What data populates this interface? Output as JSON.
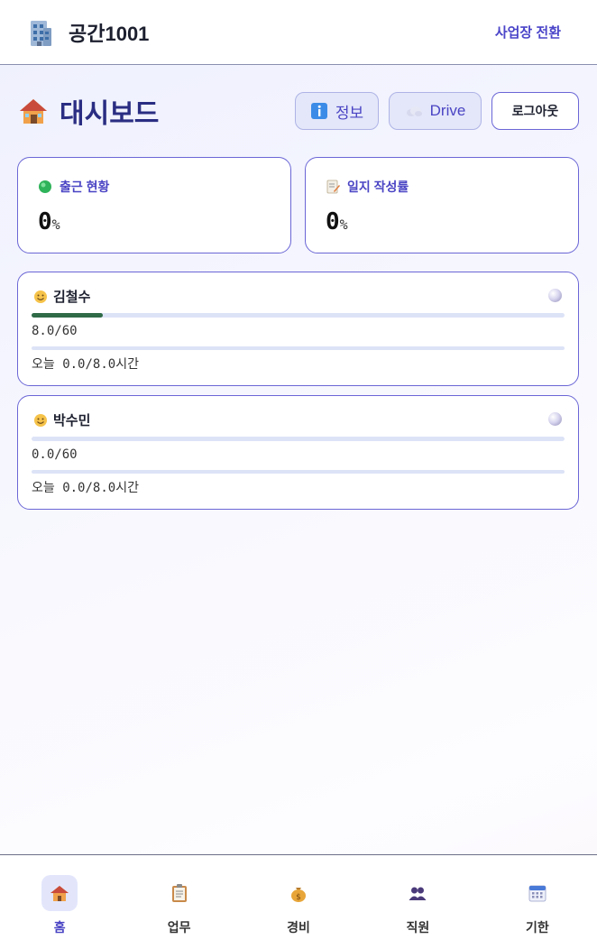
{
  "topbar": {
    "title": "공간1001",
    "switch_label": "사업장 전환",
    "logo_icon": "office-building-icon"
  },
  "dashboard": {
    "title": "대시보드",
    "title_icon": "house-icon",
    "buttons": {
      "info": "정보",
      "drive": "Drive",
      "logout": "로그아웃"
    }
  },
  "stats": [
    {
      "label": "출근 현황",
      "icon": "green-circle-icon",
      "value": "0",
      "unit": "%"
    },
    {
      "label": "일지 작성률",
      "icon": "memo-icon",
      "value": "0",
      "unit": "%"
    }
  ],
  "employees": [
    {
      "name": "김철수",
      "weekly_text": "8.0/60",
      "weekly_progress": 0.133,
      "today_text": "오늘 0.0/8.0시간",
      "today_progress": 0
    },
    {
      "name": "박수민",
      "weekly_text": "0.0/60",
      "weekly_progress": 0,
      "today_text": "오늘 0.0/8.0시간",
      "today_progress": 0
    }
  ],
  "nav": [
    {
      "label": "홈",
      "icon": "house-icon",
      "active": true
    },
    {
      "label": "업무",
      "icon": "clipboard-icon",
      "active": false
    },
    {
      "label": "경비",
      "icon": "money-bag-icon",
      "active": false
    },
    {
      "label": "직원",
      "icon": "people-icon",
      "active": false
    },
    {
      "label": "기한",
      "icon": "calendar-icon",
      "active": false
    }
  ],
  "colors": {
    "accent": "#4a44c4",
    "title": "#2a2d82",
    "progress": "#2f6b47",
    "track": "#dde3f7"
  }
}
